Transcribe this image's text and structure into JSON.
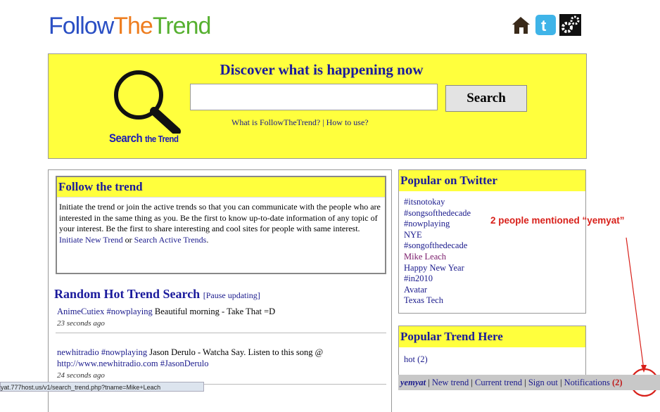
{
  "logo": {
    "part1": "Follow",
    "part2": "The",
    "part3": "Trend"
  },
  "top_icons": [
    "home-icon",
    "twitter-icon",
    "settings-gear-icon"
  ],
  "hero": {
    "title": "Discover what is happening now",
    "search_value": "",
    "search_button": "Search",
    "link_what": "What is FollowTheTrend?",
    "link_sep": "|",
    "link_how": "How to use?",
    "mag_label_big": "Search",
    "mag_label_small": "the Trend"
  },
  "follow": {
    "title": "Follow the trend",
    "body": "Initiate the trend or join the active trends so that you can communicate with the people who are interested in the same thing as you. Be the first to know up-to-date information of any topic of your interest. Be the first to share interesting and cool sites for people with same interest.",
    "link_initiate": "Initiate New Trend",
    "or": "or",
    "link_search": "Search Active Trends",
    "end": "."
  },
  "random": {
    "title": "Random Hot Trend Search",
    "pause": "[Pause updating]",
    "tweets": [
      {
        "user": "AnimeCutiex",
        "tag": "#nowplaying",
        "text": "Beautiful morning - Take That =D",
        "link": "",
        "link2": "",
        "ago": "23 seconds ago"
      },
      {
        "user": "newhitradio",
        "tag": "#nowplaying",
        "text": "Jason Derulo - Watcha Say. Listen to this song @",
        "link": "http://www.newhitradio.com",
        "link2": "#JasonDerulo",
        "ago": "24 seconds ago"
      }
    ]
  },
  "popular_twitter": {
    "title": "Popular on Twitter",
    "items": [
      "#itsnotokay",
      "#songsofthedecade",
      "#nowplaying",
      "NYE",
      "#songofthedecade",
      "Mike Leach",
      "Happy New Year",
      "#in2010",
      "Avatar",
      "Texas Tech"
    ]
  },
  "popular_here": {
    "title": "Popular Trend Here",
    "items": [
      "hot (2)"
    ]
  },
  "annotation": "2 people mentioned “yemyat”",
  "bottom_bar": {
    "user": "yemyat",
    "new_trend": "New trend",
    "current_trend": "Current trend",
    "sign_out": "Sign out",
    "notifications": "Notifications",
    "count": "(2)",
    "sep": "|"
  },
  "status_url": "yat.777host.us/v1/search_trend.php?tname=Mike+Leach",
  "colors": {
    "hero_bg": "#ffff3d",
    "link": "#1a1a8c",
    "annotation": "#d8201a",
    "logo_blue": "#2a4fc4",
    "logo_orange": "#ee7d1f",
    "logo_green": "#56b030"
  }
}
